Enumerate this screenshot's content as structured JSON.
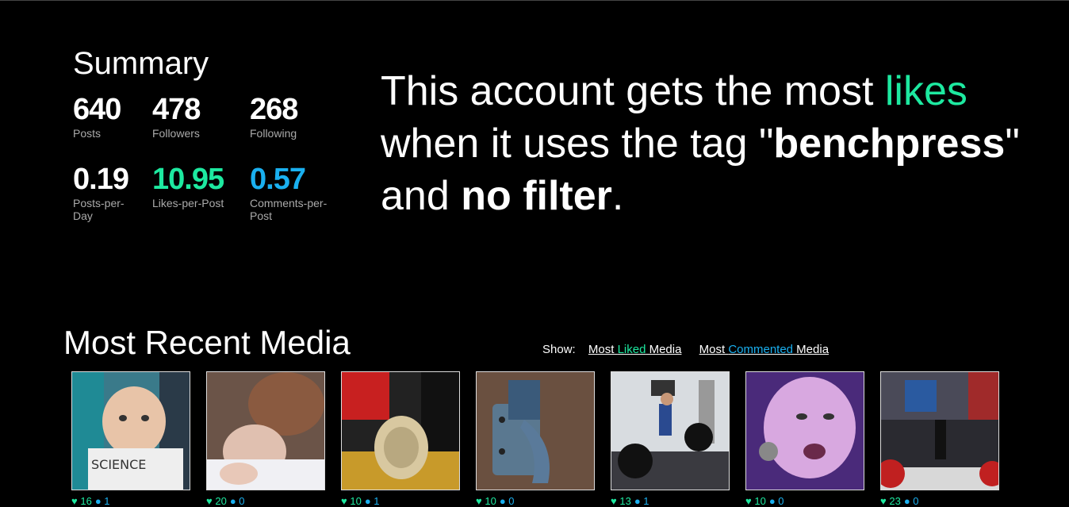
{
  "summary": {
    "title": "Summary",
    "posts": {
      "value": "640",
      "label": "Posts"
    },
    "followers": {
      "value": "478",
      "label": "Followers"
    },
    "following": {
      "value": "268",
      "label": "Following"
    },
    "posts_per_day": {
      "value": "0.19",
      "label": "Posts-per-Day"
    },
    "likes_per_post": {
      "value": "10.95",
      "label": "Likes-per-Post"
    },
    "comments_per_post": {
      "value": "0.57",
      "label": "Comments-per-Post"
    }
  },
  "headline": {
    "part1": "This account gets the most ",
    "likes_word": "likes",
    "part2": " when it uses the tag \"",
    "tag": "benchpress",
    "part3": "\" and ",
    "filter": "no filter",
    "part4": "."
  },
  "media": {
    "title": "Most Recent Media",
    "show_label": "Show:",
    "link_liked": {
      "pre": "Most ",
      "accent": "Liked",
      "post": " Media"
    },
    "link_commented": {
      "pre": "Most ",
      "accent": "Commented",
      "post": " Media"
    },
    "items": [
      {
        "likes": "16",
        "comments": "1"
      },
      {
        "likes": "20",
        "comments": "0"
      },
      {
        "likes": "10",
        "comments": "1"
      },
      {
        "likes": "10",
        "comments": "0"
      },
      {
        "likes": "13",
        "comments": "1"
      },
      {
        "likes": "10",
        "comments": "0"
      },
      {
        "likes": "23",
        "comments": "0"
      }
    ]
  },
  "colors": {
    "likes": "#1de9a0",
    "comments": "#1ab0f0",
    "background": "#000000"
  }
}
